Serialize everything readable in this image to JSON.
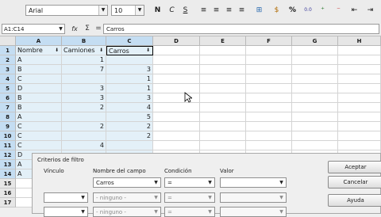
{
  "toolbar": {
    "font_name": "Arial",
    "font_size": "10",
    "bold": "N",
    "italic": "C",
    "underline": "S",
    "percent": "%",
    "currency": "$",
    "number_format": "0.0"
  },
  "formula_bar": {
    "name_box": "A1:C14",
    "function_wizard": "fx",
    "sum": "Σ",
    "equals": "=",
    "content": "Carros"
  },
  "columns": [
    "A",
    "B",
    "C",
    "D",
    "E",
    "F",
    "G",
    "H"
  ],
  "rows": [
    {
      "n": "1",
      "a": "Nombre",
      "b": "Camiones",
      "c": "Carros"
    },
    {
      "n": "2",
      "a": "A",
      "b": "1",
      "c": ""
    },
    {
      "n": "3",
      "a": "B",
      "b": "7",
      "c": "3"
    },
    {
      "n": "4",
      "a": "C",
      "b": "",
      "c": "1"
    },
    {
      "n": "5",
      "a": "D",
      "b": "3",
      "c": "1"
    },
    {
      "n": "6",
      "a": "B",
      "b": "3",
      "c": "3"
    },
    {
      "n": "7",
      "a": "B",
      "b": "2",
      "c": "4"
    },
    {
      "n": "8",
      "a": "A",
      "b": "",
      "c": "5"
    },
    {
      "n": "9",
      "a": "C",
      "b": "2",
      "c": "2"
    },
    {
      "n": "10",
      "a": "C",
      "b": "",
      "c": "2"
    },
    {
      "n": "11",
      "a": "C",
      "b": "4",
      "c": ""
    },
    {
      "n": "12",
      "a": "D",
      "b": "",
      "c": ""
    },
    {
      "n": "13",
      "a": "A",
      "b": "",
      "c": ""
    },
    {
      "n": "14",
      "a": "A",
      "b": "",
      "c": ""
    },
    {
      "n": "15",
      "a": "",
      "b": "",
      "c": ""
    },
    {
      "n": "16",
      "a": "",
      "b": "",
      "c": ""
    },
    {
      "n": "17",
      "a": "",
      "b": "",
      "c": ""
    }
  ],
  "filter_dialog": {
    "title": "Criterios de filtro",
    "headers": {
      "link": "Vínculo",
      "field": "Nombre del campo",
      "condition": "Condición",
      "value": "Valor"
    },
    "row1": {
      "field": "Carros",
      "condition": "=",
      "value": ""
    },
    "row2": {
      "link": "",
      "field": "- ninguno -",
      "condition": "=",
      "value": ""
    },
    "row3": {
      "link": "",
      "field": "- ninguno -",
      "condition": "=",
      "value": ""
    },
    "buttons": {
      "ok": "Aceptar",
      "cancel": "Cancelar",
      "help": "Ayuda"
    }
  }
}
